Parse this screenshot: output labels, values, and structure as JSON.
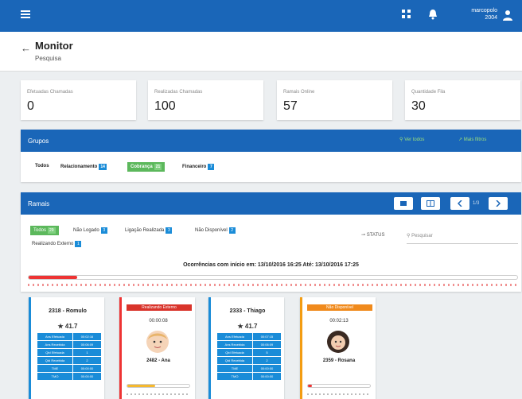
{
  "topbar": {
    "username": "marcopolo",
    "user_ext": "2004"
  },
  "header": {
    "title": "Monitor",
    "subtitle": "Pesquisa"
  },
  "stats": [
    {
      "label": "Efetuadas Chamadas",
      "value": "0"
    },
    {
      "label": "Realizadas Chamadas",
      "value": "100"
    },
    {
      "label": "Ramais Online",
      "value": "57"
    },
    {
      "label": "Quantidade Fila",
      "value": "30"
    }
  ],
  "groups": {
    "title": "Grupos",
    "action_1": "Ver todos",
    "action_2": "Mais filtros",
    "chips": [
      {
        "label": "Todos",
        "count": ""
      },
      {
        "label": "Relacionamento",
        "count": "14"
      },
      {
        "label": "Cobrança",
        "count": "21"
      },
      {
        "label": "Financeiro",
        "count": "7"
      }
    ]
  },
  "ramais": {
    "title": "Ramais",
    "page": "1/3",
    "filters": [
      {
        "label": "Todos",
        "count": "29"
      },
      {
        "label": "Não Logado",
        "count": "3"
      },
      {
        "label": "Ligação Realizada",
        "count": "3"
      },
      {
        "label": "Não Disponível",
        "count": "2"
      },
      {
        "label": "Realizando Externo",
        "count": "1"
      }
    ],
    "status_label": "STATUS",
    "search_placeholder": "Pesquisar",
    "occurrences": "Ocorrências com início em: 13/10/2016 16:25 Até: 13/10/2016 17:25",
    "timeline_progress": 0.1
  },
  "cards": [
    {
      "name": "2318 - Romulo",
      "score": "★ 41.7",
      "metrics": [
        {
          "k": "Ans Efetuada",
          "v": "00:02:16"
        },
        {
          "k": "Ans Recebida",
          "v": "00:06:09"
        },
        {
          "k": "Qtd Efetuada",
          "v": "1"
        },
        {
          "k": "Qtd Recebida",
          "v": "2"
        },
        {
          "k": "TME",
          "v": "00:00:00"
        },
        {
          "k": "TMO",
          "v": "00:00:00"
        }
      ]
    },
    {
      "tag": "Realizando Externo",
      "timer": "00:00:08",
      "name": "2482 - Ana",
      "progress": 0.45,
      "color": "#f5b82e"
    },
    {
      "name": "2333 - Thiago",
      "score": "★ 41.7",
      "metrics": [
        {
          "k": "Ans Efetuada",
          "v": "00:07:15"
        },
        {
          "k": "Ans Recebida",
          "v": "00:06:09"
        },
        {
          "k": "Qtd Efetuada",
          "v": "5"
        },
        {
          "k": "Qtd Recebida",
          "v": "2"
        },
        {
          "k": "TME",
          "v": "00:00:00"
        },
        {
          "k": "TMO",
          "v": "00:00:00"
        }
      ]
    },
    {
      "tag": "Não Disponível",
      "timer": "00:02:13",
      "name": "2359 - Rosana",
      "progress": 0.05,
      "color": "#e33"
    }
  ]
}
